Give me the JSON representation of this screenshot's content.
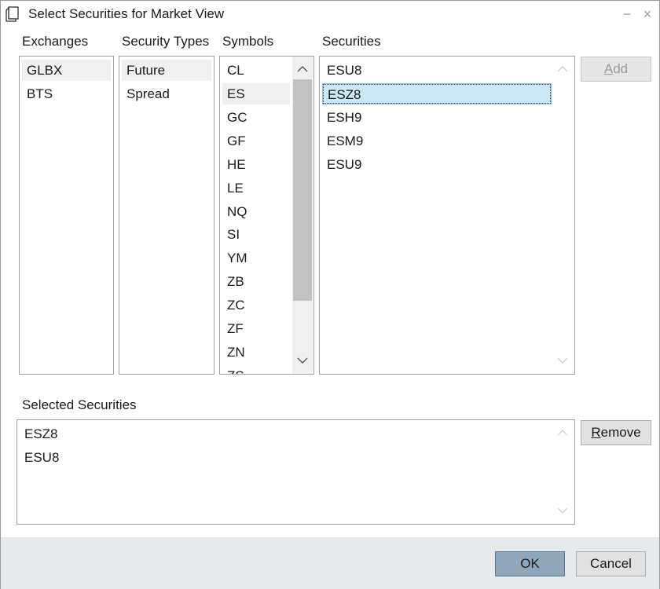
{
  "window": {
    "title": "Select Securities for Market View",
    "minimize_glyph": "−",
    "close_glyph": "×"
  },
  "columns": {
    "exchanges_label": "Exchanges",
    "security_types_label": "Security Types",
    "symbols_label": "Symbols",
    "securities_label": "Securities"
  },
  "exchanges": [
    "GLBX",
    "BTS"
  ],
  "security_types": [
    "Future",
    "Spread"
  ],
  "symbols": [
    "CL",
    "ES",
    "GC",
    "GF",
    "HE",
    "LE",
    "NQ",
    "SI",
    "YM",
    "ZB",
    "ZC",
    "ZF",
    "ZN",
    "ZS"
  ],
  "securities": [
    "ESU8",
    "ESZ8",
    "ESH9",
    "ESM9",
    "ESU9"
  ],
  "selected_section_label": "Selected Securities",
  "selected_securities": [
    "ESZ8",
    "ESU8"
  ],
  "buttons": {
    "add_prefix": "",
    "add_mnemonic": "A",
    "add_rest": "dd",
    "remove_prefix": "",
    "remove_mnemonic": "R",
    "remove_rest": "emove",
    "ok": "OK",
    "cancel": "Cancel"
  },
  "colors": {
    "selection_blue": "#cce8f6",
    "selection_grey": "#f0f0f0",
    "primary_button": "#8fa6bb",
    "footer_bg": "#e7eaed"
  }
}
